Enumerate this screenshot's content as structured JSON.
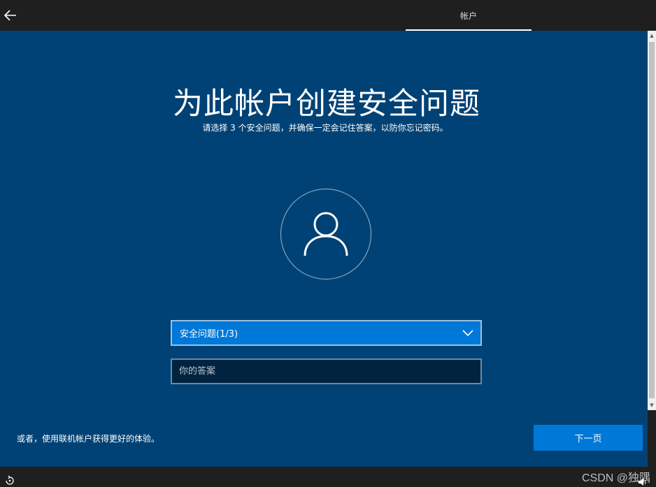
{
  "header": {
    "back_icon": "arrow-left-icon",
    "tab_label": "帐户"
  },
  "main": {
    "title": "为此帐户创建安全问题",
    "subtitle": "请选择 3 个安全问题，并确保一定会记住答案，以防你忘记密码。",
    "avatar_icon": "user-icon",
    "question_select": {
      "value": "安全问题(1/3)",
      "icon": "chevron-down-icon"
    },
    "answer_field": {
      "placeholder": "你的答案",
      "value": ""
    },
    "alt_link": "或者，使用联机帐户获得更好的体验。",
    "next_button": "下一页"
  },
  "footer": {
    "ease_of_access_icon": "ease-of-access-icon",
    "volume_icon": "volume-icon",
    "watermark": "CSDN @独隅"
  },
  "colors": {
    "main_background": "#004275",
    "accent": "#0078d7",
    "chrome": "#1f1f1f",
    "input_background": "#002440"
  }
}
